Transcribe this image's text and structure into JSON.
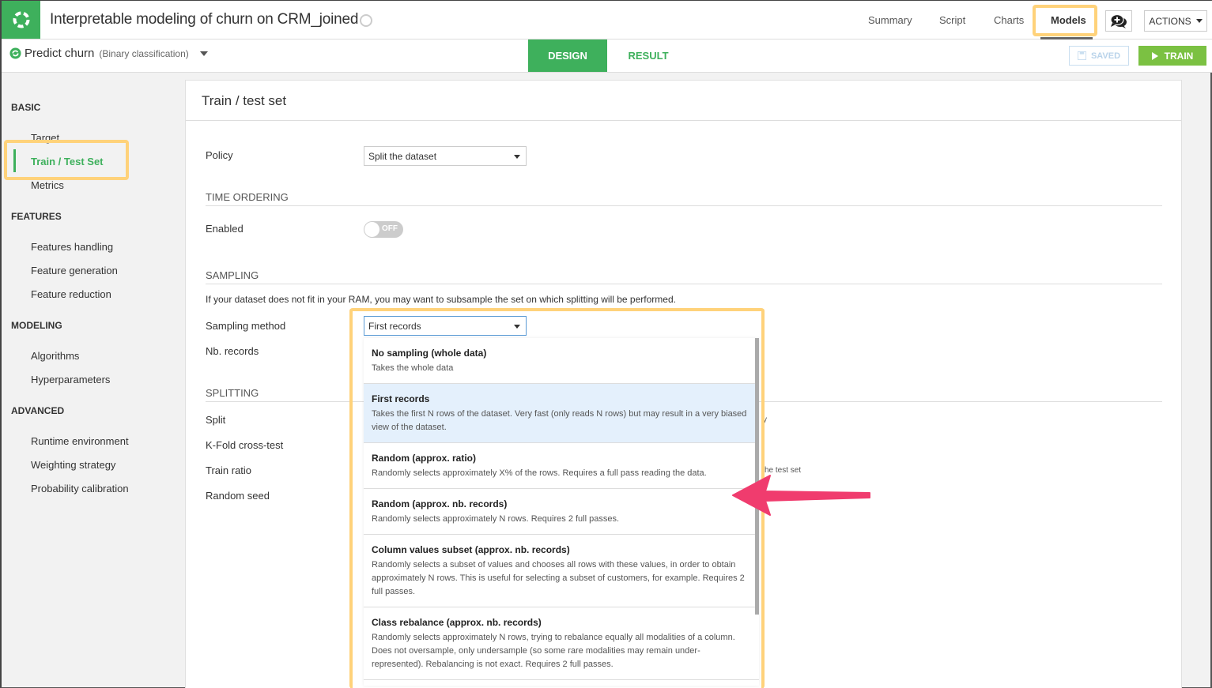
{
  "header": {
    "app_title": "Interpretable modeling of churn on CRM_joined",
    "nav": [
      "Summary",
      "Script",
      "Charts",
      "Models"
    ],
    "active_nav": "Models",
    "actions_label": "ACTIONS"
  },
  "subbar": {
    "model_name": "Predict churn",
    "model_type": "(Binary classification)",
    "tabs": [
      "DESIGN",
      "RESULT"
    ],
    "active_tab": "DESIGN",
    "saved_label": "SAVED",
    "train_label": "TRAIN"
  },
  "colors": {
    "brand_green": "#3eb05c",
    "train_green": "#7bc142",
    "highlight": "#ffd27a",
    "arrow": "#f03c6e",
    "selected_option_bg": "#e4f0fc"
  },
  "sidebar": {
    "sections": [
      {
        "title": "BASIC",
        "items": [
          "Target",
          "Train / Test Set",
          "Metrics"
        ]
      },
      {
        "title": "FEATURES",
        "items": [
          "Features handling",
          "Feature generation",
          "Feature reduction"
        ]
      },
      {
        "title": "MODELING",
        "items": [
          "Algorithms",
          "Hyperparameters"
        ]
      },
      {
        "title": "ADVANCED",
        "items": [
          "Runtime environment",
          "Weighting strategy",
          "Probability calibration"
        ]
      }
    ],
    "active_item": "Train / Test Set"
  },
  "panel": {
    "title": "Train / test set",
    "policy_label": "Policy",
    "policy_value": "Split the dataset",
    "time_ordering_heading": "TIME ORDERING",
    "enabled_label": "Enabled",
    "enabled_state": "OFF",
    "sampling_heading": "SAMPLING",
    "sampling_desc": "If your dataset does not fit in your RAM, you may want to subsample the set on which splitting will be performed.",
    "sampling_method_label": "Sampling method",
    "sampling_method_value": "First records",
    "nb_records_label": "Nb. records",
    "splitting_heading": "SPLITTING",
    "split_label": "Split",
    "kfold_label": "K-Fold cross-test",
    "train_ratio_label": "Train ratio",
    "random_seed_label": "Random seed",
    "partial_text_1": "y",
    "partial_text_2": "he test set"
  },
  "dropdown": {
    "options": [
      {
        "title": "No sampling (whole data)",
        "desc": "Takes the whole data"
      },
      {
        "title": "First records",
        "desc": "Takes the first N rows of the dataset. Very fast (only reads N rows) but may result in a very biased view of the dataset."
      },
      {
        "title": "Random (approx. ratio)",
        "desc": "Randomly selects approximately X% of the rows. Requires a full pass reading the data."
      },
      {
        "title": "Random (approx. nb. records)",
        "desc": "Randomly selects approximately N rows. Requires 2 full passes."
      },
      {
        "title": "Column values subset (approx. nb. records)",
        "desc": "Randomly selects a subset of values and chooses all rows with these values, in order to obtain approximately N rows. This is useful for selecting a subset of customers, for example. Requires 2 full passes."
      },
      {
        "title": "Class rebalance (approx. nb. records)",
        "desc": "Randomly selects approximately N rows, trying to rebalance equally all modalities of a column. Does not oversample, only undersample (so some rare modalities may remain under-represented). Rebalancing is not exact. Requires 2 full passes."
      }
    ],
    "selected_index": 1
  }
}
